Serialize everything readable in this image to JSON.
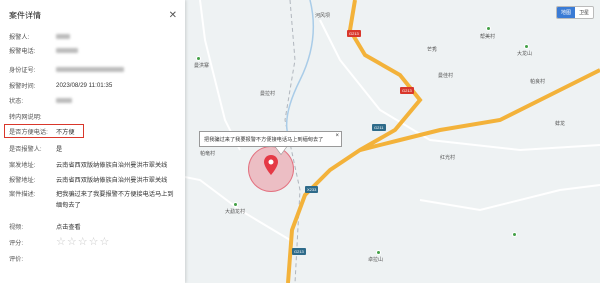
{
  "panel": {
    "title": "案件详情",
    "fields": [
      {
        "label": "报警人:",
        "value": "",
        "blurred": true
      },
      {
        "label": "报警电话:",
        "value": "",
        "blurred": true
      },
      {
        "label": "身份证号:",
        "value": "",
        "blurred": true
      },
      {
        "label": "报警时间:",
        "value": "2023/08/29 11:01:35"
      },
      {
        "label": "状态:",
        "value": "",
        "blurred": true
      },
      {
        "label": "转内网说明:",
        "value": ""
      },
      {
        "label": "是否方便电话:",
        "value": "不方便"
      },
      {
        "label": "是否报警人:",
        "value": "是"
      },
      {
        "label": "案发地址:",
        "value": "云南省西双版纳傣族自治州曼洪市翠关线"
      },
      {
        "label": "报警地址:",
        "value": "云南省西双版纳傣族自治州曼洪市翠关线"
      }
    ],
    "description_label": "案件描述:",
    "description": "把我骗过来了我要报警不方便接电话马上到缅甸去了",
    "video_label": "视频:",
    "video_link": "点击查看",
    "rating_label": "评分:",
    "rating_value": 0,
    "rating_max": 5,
    "review_label": "评价:"
  },
  "map": {
    "type_buttons": [
      "地图",
      "卫星"
    ],
    "active_type": "地图",
    "popup_text": "把我骗过来了我要报警不方便接电话马上到缅甸去了",
    "popup_close": "×",
    "places": [
      "河风坝",
      "曼洪寨",
      "大龙山",
      "帮美村",
      "芒秀",
      "帕良村",
      "曼拉村",
      "曼佳村",
      "红光村",
      "蚌龙",
      "帕竜村",
      "大勐龙村",
      "卓拉山"
    ],
    "road_badges": [
      "G213",
      "G213",
      "G211",
      "X233",
      "G213"
    ]
  }
}
